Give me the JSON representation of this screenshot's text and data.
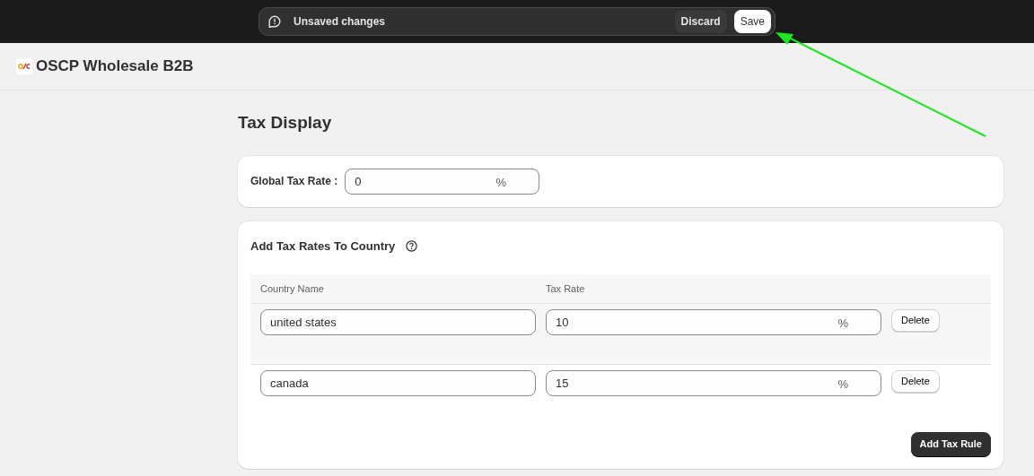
{
  "save_bar": {
    "message": "Unsaved changes",
    "buttons": [
      {
        "label": "Discard",
        "kind": "secondary"
      },
      {
        "label": "Save",
        "kind": "primary"
      }
    ]
  },
  "app": {
    "title": "OSCP Wholesale B2B"
  },
  "page": {
    "title": "Tax Display"
  },
  "global_tax": {
    "label": "Global Tax Rate :",
    "value": "0",
    "suffix": "%"
  },
  "country_rates": {
    "title": "Add Tax Rates To Country",
    "columns": [
      "Country Name",
      "Tax Rate"
    ],
    "rows": [
      {
        "country": "united states",
        "rate": "10",
        "suffix": "%",
        "delete": "Delete",
        "highlighted": true
      },
      {
        "country": "canada",
        "rate": "15",
        "suffix": "%",
        "delete": "Delete",
        "highlighted": false
      }
    ],
    "add_button": "Add Tax Rule"
  }
}
